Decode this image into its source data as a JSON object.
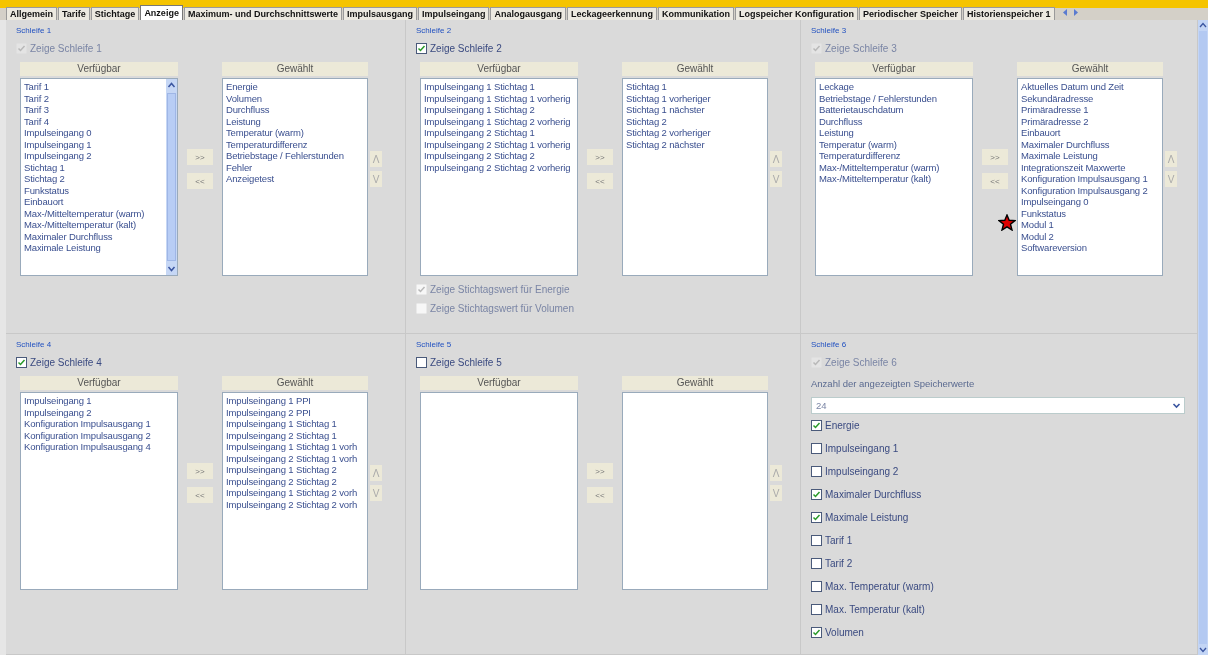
{
  "tabs": [
    {
      "label": "Allgemein",
      "selected": false
    },
    {
      "label": "Tarife",
      "selected": false
    },
    {
      "label": "Stichtage",
      "selected": false
    },
    {
      "label": "Anzeige",
      "selected": true
    },
    {
      "label": "Maximum- und Durchschnittswerte",
      "selected": false
    },
    {
      "label": "Impulsausgang",
      "selected": false
    },
    {
      "label": "Impulseingang",
      "selected": false
    },
    {
      "label": "Analogausgang",
      "selected": false
    },
    {
      "label": "Leckageerkennung",
      "selected": false
    },
    {
      "label": "Kommunikation",
      "selected": false
    },
    {
      "label": "Logspeicher Konfiguration",
      "selected": false
    },
    {
      "label": "Periodischer Speicher",
      "selected": false
    },
    {
      "label": "Historienspeicher 1",
      "selected": false
    }
  ],
  "loops": [
    {
      "kind": "lists",
      "title": "Schleife 1",
      "show": {
        "label": "Zeige Schleife 1",
        "checked": true,
        "disabled": true
      },
      "available": {
        "header": "Verfügbar",
        "scrollable": true,
        "items": [
          "Tarif 1",
          "Tarif 2",
          "Tarif 3",
          "Tarif 4",
          "Impulseingang 0",
          "Impulseingang 1",
          "Impulseingang 2",
          "Stichtag 1",
          "Stichtag 2",
          "Funkstatus",
          "Einbauort",
          "Max-/Mitteltemperatur (warm)",
          "Max-/Mitteltemperatur (kalt)",
          "Maximaler Durchfluss",
          "Maximale Leistung"
        ]
      },
      "chosen": {
        "header": "Gewählt",
        "items": [
          "Energie",
          "Volumen",
          "Durchfluss",
          "Leistung",
          "Temperatur (warm)",
          "Temperaturdifferenz",
          "Betriebstage / Fehlerstunden",
          "Fehler",
          "Anzeigetest"
        ]
      },
      "add_button": ">>",
      "remove_button": "<<",
      "up_button": "Λ",
      "down_button": "V"
    },
    {
      "kind": "lists",
      "title": "Schleife 2",
      "show": {
        "label": "Zeige Schleife 2",
        "checked": true,
        "disabled": false
      },
      "available": {
        "header": "Verfügbar",
        "scrollable": false,
        "items": [
          "Impulseingang 1 Stichtag 1",
          "Impulseingang 1 Stichtag 1 vorherig",
          "Impulseingang 1 Stichtag 2",
          "Impulseingang 1 Stichtag 2 vorherig",
          "Impulseingang 2 Stichtag 1",
          "Impulseingang 2 Stichtag 1 vorherig",
          "Impulseingang 2 Stichtag 2",
          "Impulseingang 2 Stichtag 2 vorherig"
        ]
      },
      "chosen": {
        "header": "Gewählt",
        "items": [
          "Stichtag 1",
          "Stichtag 1 vorheriger",
          "Stichtag 1 nächster",
          "Stichtag 2",
          "Stichtag 2 vorheriger",
          "Stichtag 2 nächster"
        ]
      },
      "add_button": ">>",
      "remove_button": "<<",
      "up_button": "Λ",
      "down_button": "V",
      "options": [
        {
          "label": "Zeige Stichtagswert für Energie",
          "checked": true,
          "disabled": true
        },
        {
          "label": "Zeige Stichtagswert für Volumen",
          "checked": false,
          "disabled": true
        }
      ]
    },
    {
      "kind": "lists",
      "title": "Schleife 3",
      "show": {
        "label": "Zeige Schleife 3",
        "checked": true,
        "disabled": true
      },
      "available": {
        "header": "Verfügbar",
        "scrollable": false,
        "items": [
          "Leckage",
          "Betriebstage / Fehlerstunden",
          "Batterietauschdatum",
          "Durchfluss",
          "Leistung",
          "Temperatur (warm)",
          "Temperaturdifferenz",
          "Max-/Mitteltemperatur (warm)",
          "Max-/Mitteltemperatur (kalt)"
        ]
      },
      "chosen": {
        "header": "Gewählt",
        "items": [
          "Aktuelles Datum und Zeit",
          "Sekundäradresse",
          "Primäradresse 1",
          "Primäradresse 2",
          "Einbauort",
          "Maximaler Durchfluss",
          "Maximale Leistung",
          "Integrationszeit Maxwerte",
          "Konfiguration Impulsausgang 1",
          "Konfiguration Impulsausgang 2",
          "Impulseingang 0",
          "Funkstatus",
          "Modul 1",
          "Modul 2",
          "Softwareversion"
        ]
      },
      "add_button": ">>",
      "remove_button": "<<",
      "up_button": "Λ",
      "down_button": "V"
    },
    {
      "kind": "lists",
      "title": "Schleife 4",
      "show": {
        "label": "Zeige Schleife 4",
        "checked": true,
        "disabled": false
      },
      "available": {
        "header": "Verfügbar",
        "scrollable": false,
        "items": [
          "Impulseingang 1",
          "Impulseingang 2",
          "Konfiguration Impulsausgang 1",
          "Konfiguration Impulsausgang 2",
          "Konfiguration Impulsausgang 4"
        ]
      },
      "chosen": {
        "header": "Gewählt",
        "items": [
          "Impulseingang 1 PPI",
          "Impulseingang 2 PPI",
          "Impulseingang 1 Stichtag 1",
          "Impulseingang 2 Stichtag 1",
          "Impulseingang 1 Stichtag 1 vorh",
          "Impulseingang 2 Stichtag 1 vorh",
          "Impulseingang 1 Stichtag 2",
          "Impulseingang 2 Stichtag 2",
          "Impulseingang 1 Stichtag 2 vorh",
          "Impulseingang 2 Stichtag 2 vorh"
        ]
      },
      "add_button": ">>",
      "remove_button": "<<",
      "up_button": "Λ",
      "down_button": "V"
    },
    {
      "kind": "lists",
      "title": "Schleife 5",
      "show": {
        "label": "Zeige Schleife 5",
        "checked": false,
        "disabled": false
      },
      "available": {
        "header": "Verfügbar",
        "scrollable": false
      },
      "chosen": {
        "header": "Gewählt"
      },
      "add_button": ">>",
      "remove_button": "<<",
      "up_button": "Λ",
      "down_button": "V"
    },
    {
      "kind": "storage",
      "title": "Schleife 6",
      "show": {
        "label": "Zeige Schleife 6",
        "checked": true,
        "disabled": true
      },
      "count_label": "Anzahl der angezeigten Speicherwerte",
      "count": {
        "value": "24"
      },
      "options": [
        {
          "label": "Energie",
          "checked": true,
          "disabled": false
        },
        {
          "label": "Impulseingang 1",
          "checked": false,
          "disabled": false
        },
        {
          "label": "Impulseingang 2",
          "checked": false,
          "disabled": false
        },
        {
          "label": "Maximaler Durchfluss",
          "checked": true,
          "disabled": false
        },
        {
          "label": "Maximale Leistung",
          "checked": true,
          "disabled": false
        },
        {
          "label": "Tarif 1",
          "checked": false,
          "disabled": false
        },
        {
          "label": "Tarif 2",
          "checked": false,
          "disabled": false
        },
        {
          "label": "Max. Temperatur (warm)",
          "checked": false,
          "disabled": false
        },
        {
          "label": "Max. Temperatur (kalt)",
          "checked": false,
          "disabled": false
        },
        {
          "label": "Volumen",
          "checked": true,
          "disabled": false
        }
      ]
    }
  ]
}
